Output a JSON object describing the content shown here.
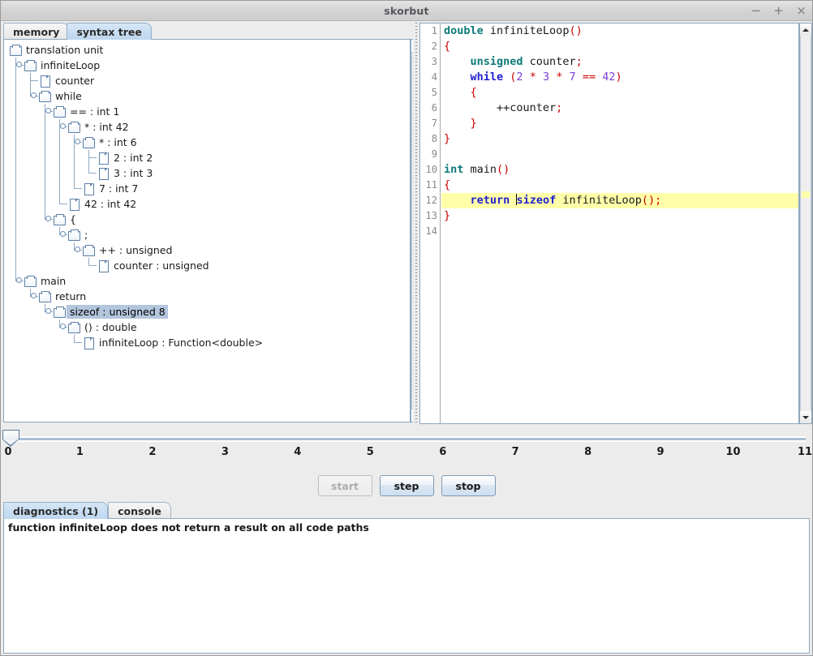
{
  "window": {
    "title": "skorbut",
    "controls": [
      {
        "name": "minimize",
        "glyph": "−"
      },
      {
        "name": "maximize",
        "glyph": "+"
      },
      {
        "name": "close",
        "glyph": "×"
      }
    ]
  },
  "left_panel": {
    "tabs": [
      {
        "label": "memory",
        "selected": false
      },
      {
        "label": "syntax tree",
        "selected": true
      }
    ],
    "tree": [
      {
        "label": "translation unit",
        "depth": 0,
        "icon": "folder",
        "handle": false,
        "selected": false
      },
      {
        "label": "infiniteLoop",
        "depth": 1,
        "icon": "folder",
        "handle": true,
        "selected": false
      },
      {
        "label": "counter",
        "depth": 2,
        "icon": "leaf",
        "handle": false,
        "selected": false
      },
      {
        "label": "while",
        "depth": 2,
        "icon": "folder",
        "handle": true,
        "selected": false
      },
      {
        "label": "== : int 1",
        "depth": 3,
        "icon": "folder",
        "handle": true,
        "selected": false
      },
      {
        "label": "* : int 42",
        "depth": 4,
        "icon": "folder",
        "handle": true,
        "selected": false
      },
      {
        "label": "* : int 6",
        "depth": 5,
        "icon": "folder",
        "handle": true,
        "selected": false
      },
      {
        "label": "2 : int 2",
        "depth": 6,
        "icon": "leaf",
        "handle": false,
        "selected": false
      },
      {
        "label": "3 : int 3",
        "depth": 6,
        "icon": "leaf",
        "handle": false,
        "selected": false
      },
      {
        "label": "7 : int 7",
        "depth": 5,
        "icon": "leaf",
        "handle": false,
        "selected": false
      },
      {
        "label": "42 : int 42",
        "depth": 4,
        "icon": "leaf",
        "handle": false,
        "selected": false
      },
      {
        "label": "{",
        "depth": 3,
        "icon": "folder",
        "handle": true,
        "selected": false
      },
      {
        "label": ";",
        "depth": 4,
        "icon": "folder",
        "handle": true,
        "selected": false
      },
      {
        "label": "++ : unsigned",
        "depth": 5,
        "icon": "folder",
        "handle": true,
        "selected": false
      },
      {
        "label": "counter : unsigned",
        "depth": 6,
        "icon": "leaf",
        "handle": false,
        "selected": false
      },
      {
        "label": "main",
        "depth": 1,
        "icon": "folder",
        "handle": true,
        "selected": false
      },
      {
        "label": "return",
        "depth": 2,
        "icon": "folder",
        "handle": true,
        "selected": false
      },
      {
        "label": "sizeof : unsigned 8",
        "depth": 3,
        "icon": "folder",
        "handle": true,
        "selected": true
      },
      {
        "label": "() : double",
        "depth": 4,
        "icon": "folder",
        "handle": true,
        "selected": false
      },
      {
        "label": "infiniteLoop : Function<double>",
        "depth": 5,
        "icon": "leaf",
        "handle": false,
        "selected": false
      }
    ]
  },
  "editor": {
    "line_numbers": [
      1,
      2,
      3,
      4,
      5,
      6,
      7,
      8,
      9,
      10,
      11,
      12,
      13,
      14
    ],
    "lines": [
      {
        "n": 1,
        "highlight": false,
        "tokens": [
          {
            "t": "double",
            "c": "kw-type"
          },
          {
            "t": " infiniteLoop"
          },
          {
            "t": "()",
            "c": "punct"
          }
        ]
      },
      {
        "n": 2,
        "highlight": false,
        "tokens": [
          {
            "t": "{",
            "c": "punct"
          }
        ]
      },
      {
        "n": 3,
        "highlight": false,
        "tokens": [
          {
            "t": "    "
          },
          {
            "t": "unsigned",
            "c": "kw-type"
          },
          {
            "t": " counter"
          },
          {
            "t": ";",
            "c": "punct"
          }
        ]
      },
      {
        "n": 4,
        "highlight": false,
        "tokens": [
          {
            "t": "    "
          },
          {
            "t": "while",
            "c": "kw-ctl"
          },
          {
            "t": " (",
            "c": "punct"
          },
          {
            "t": "2",
            "c": "num"
          },
          {
            "t": " "
          },
          {
            "t": "*",
            "c": "op"
          },
          {
            "t": " "
          },
          {
            "t": "3",
            "c": "num"
          },
          {
            "t": " "
          },
          {
            "t": "*",
            "c": "op"
          },
          {
            "t": " "
          },
          {
            "t": "7",
            "c": "num"
          },
          {
            "t": " "
          },
          {
            "t": "==",
            "c": "op"
          },
          {
            "t": " "
          },
          {
            "t": "42",
            "c": "num"
          },
          {
            "t": ")",
            "c": "punct"
          }
        ]
      },
      {
        "n": 5,
        "highlight": false,
        "tokens": [
          {
            "t": "    "
          },
          {
            "t": "{",
            "c": "punct"
          }
        ]
      },
      {
        "n": 6,
        "highlight": false,
        "tokens": [
          {
            "t": "        ++counter"
          },
          {
            "t": ";",
            "c": "punct"
          }
        ]
      },
      {
        "n": 7,
        "highlight": false,
        "tokens": [
          {
            "t": "    "
          },
          {
            "t": "}",
            "c": "punct"
          }
        ]
      },
      {
        "n": 8,
        "highlight": false,
        "tokens": [
          {
            "t": "}",
            "c": "punct"
          }
        ]
      },
      {
        "n": 9,
        "highlight": false,
        "tokens": [
          {
            "t": ""
          }
        ]
      },
      {
        "n": 10,
        "highlight": false,
        "tokens": [
          {
            "t": "int",
            "c": "kw-type"
          },
          {
            "t": " main"
          },
          {
            "t": "()",
            "c": "punct"
          }
        ]
      },
      {
        "n": 11,
        "highlight": false,
        "tokens": [
          {
            "t": "{",
            "c": "punct"
          }
        ]
      },
      {
        "n": 12,
        "highlight": true,
        "caret_before": "sizeof",
        "tokens": [
          {
            "t": "    "
          },
          {
            "t": "return",
            "c": "kw-ctl"
          },
          {
            "t": " "
          },
          {
            "t": "CARET"
          },
          {
            "t": "sizeof",
            "c": "kw-ctl"
          },
          {
            "t": " infiniteLoop"
          },
          {
            "t": "();",
            "c": "punct"
          }
        ]
      },
      {
        "n": 13,
        "highlight": false,
        "tokens": [
          {
            "t": "}",
            "c": "punct"
          }
        ]
      },
      {
        "n": 14,
        "highlight": false,
        "tokens": [
          {
            "t": ""
          }
        ]
      }
    ]
  },
  "timeline": {
    "ticks": [
      "0",
      "1",
      "2",
      "3",
      "4",
      "5",
      "6",
      "7",
      "8",
      "9",
      "10",
      "11"
    ],
    "value": 0,
    "min": 0,
    "max": 11
  },
  "buttons": [
    {
      "label": "start",
      "enabled": false
    },
    {
      "label": "step",
      "enabled": true
    },
    {
      "label": "stop",
      "enabled": true
    }
  ],
  "bottom_panel": {
    "tabs": [
      {
        "label": "diagnostics (1)",
        "selected": true
      },
      {
        "label": "console",
        "selected": false
      }
    ],
    "diagnostics": [
      "function infiniteLoop does not return a result on all code paths"
    ]
  },
  "colors": {
    "selection": "#b3c6dd",
    "tab_selected": "#bed7ef",
    "highlight_line": "#ffffaa",
    "keyword_type": "#0e7a77",
    "keyword_control": "#2222cc",
    "punctuation": "#cc0000",
    "number": "#7b3fd4"
  }
}
